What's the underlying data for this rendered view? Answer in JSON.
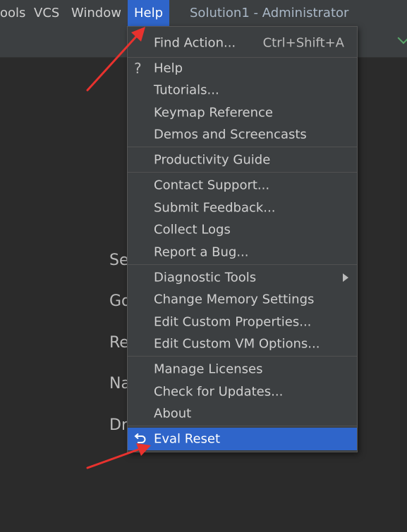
{
  "menubar": {
    "items": [
      "ools",
      "VCS",
      "Window",
      "Help"
    ],
    "title": "Solution1 - Administrator"
  },
  "background_text": [
    "Se",
    "Go",
    "Re",
    "Na",
    "Dr"
  ],
  "help_menu": {
    "find_action": {
      "label": "Find Action...",
      "shortcut": "Ctrl+Shift+A"
    },
    "help": {
      "icon": "question-mark-icon",
      "label": "Help"
    },
    "tutorials": "Tutorials...",
    "keymap_reference": "Keymap Reference",
    "demos": "Demos and Screencasts",
    "productivity_guide": "Productivity Guide",
    "contact_support": "Contact Support...",
    "submit_feedback": "Submit Feedback...",
    "collect_logs": "Collect Logs",
    "report_bug": "Report a Bug...",
    "diagnostic_tools": "Diagnostic Tools",
    "change_memory": "Change Memory Settings",
    "edit_properties": "Edit Custom Properties...",
    "edit_vm_options": "Edit Custom VM Options...",
    "manage_licenses": "Manage Licenses",
    "check_updates": "Check for Updates...",
    "about": "About",
    "eval_reset": {
      "icon": "undo-arrow-icon",
      "label": "Eval Reset"
    }
  },
  "colors": {
    "accent": "#2f65ca",
    "annotation_arrow": "#e8322e",
    "menu_background": "#3c3f41",
    "editor_background": "#2b2b2b"
  }
}
